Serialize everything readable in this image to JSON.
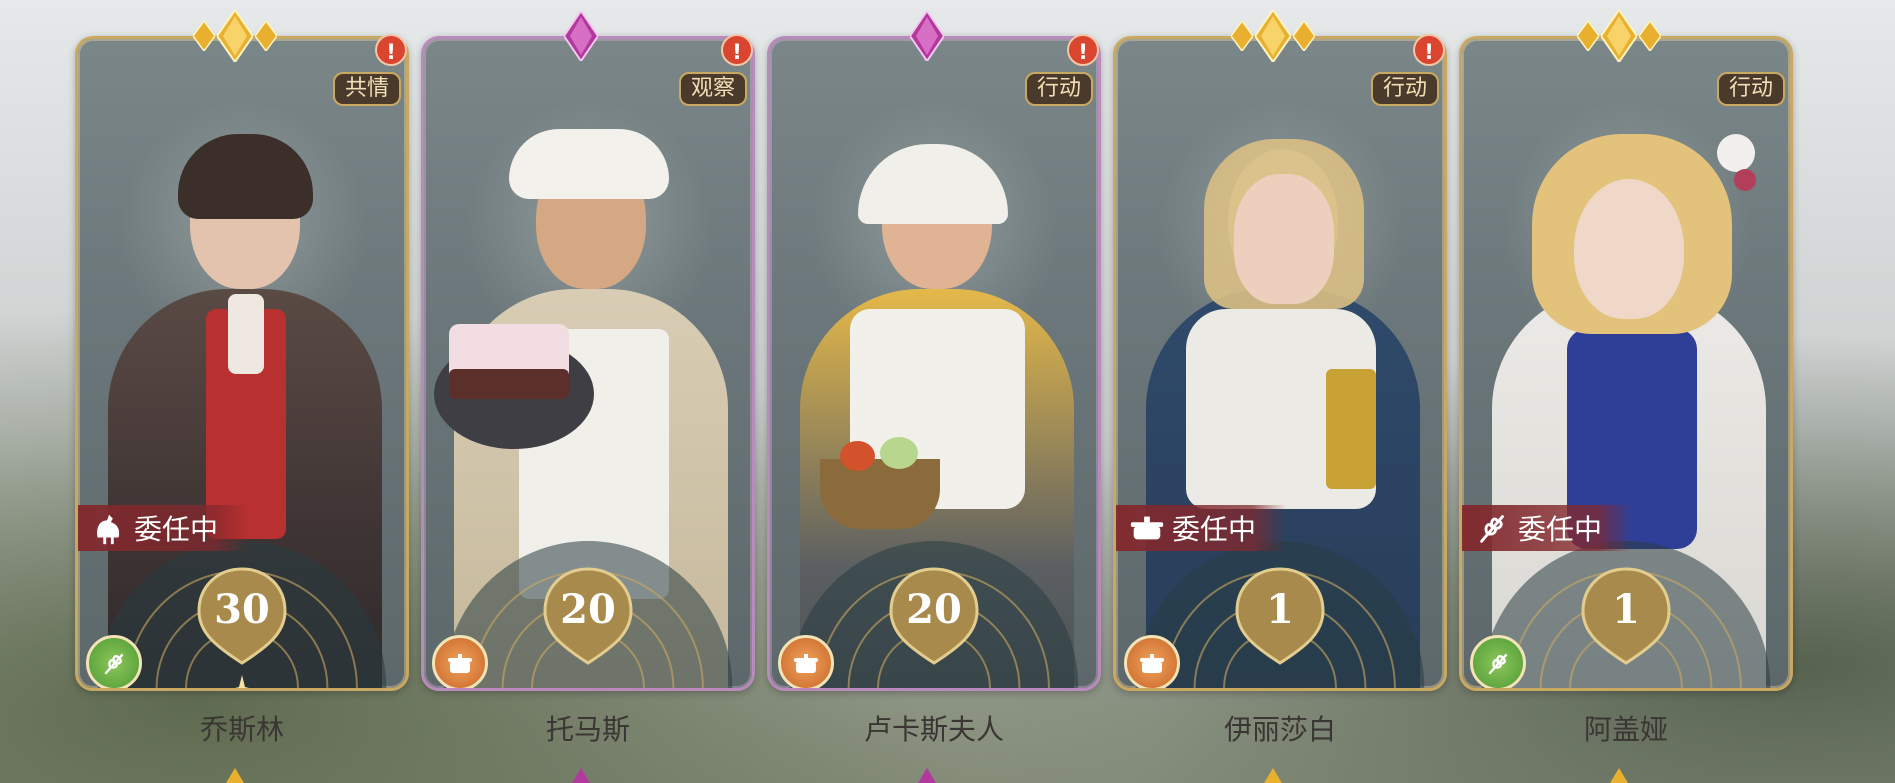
{
  "cards": [
    {
      "name": "乔斯林",
      "trait": "共情",
      "level": "30",
      "status": "委任中",
      "status_icon": "rooster-icon",
      "skill_icon": "wheat-icon",
      "skill_color": "#5ea33c",
      "rarity": "gold",
      "has_alert": true,
      "has_star": true
    },
    {
      "name": "托马斯",
      "trait": "观察",
      "level": "20",
      "status": "",
      "skill_icon": "cooking-pot-icon",
      "skill_color": "#d9763a",
      "rarity": "purple",
      "has_alert": true
    },
    {
      "name": "卢卡斯夫人",
      "trait": "行动",
      "level": "20",
      "status": "",
      "skill_icon": "cooking-pot-icon",
      "skill_color": "#d9763a",
      "rarity": "purple",
      "has_alert": true
    },
    {
      "name": "伊丽莎白",
      "trait": "行动",
      "level": "1",
      "status": "委任中",
      "status_icon": "cooking-pot-icon",
      "skill_icon": "cooking-pot-icon",
      "skill_color": "#d9763a",
      "rarity": "gold",
      "has_alert": true
    },
    {
      "name": "阿盖娅",
      "trait": "行动",
      "level": "1",
      "status": "委任中",
      "status_icon": "wheat-icon",
      "skill_icon": "wheat-icon",
      "skill_color": "#5ea33c",
      "rarity": "gold",
      "has_alert": false
    }
  ],
  "alert_glyph": "!",
  "colors": {
    "gold_border": "#c9a962",
    "purple_gem": "#b2389e",
    "gold_gem": "#e8b02e",
    "assign_banner": "#82282d",
    "alert": "#d9452e"
  }
}
